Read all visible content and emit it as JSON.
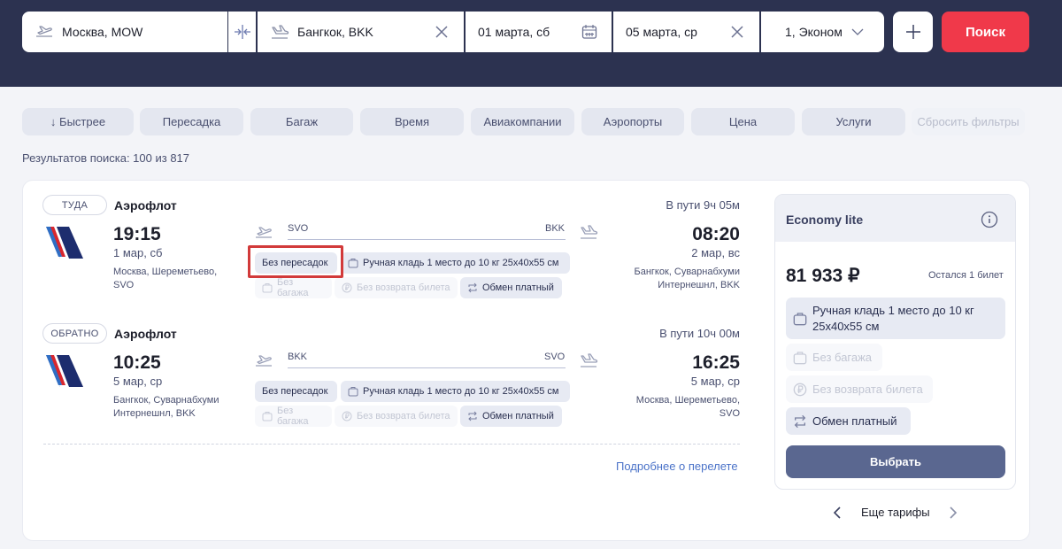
{
  "search": {
    "from": "Москва, MOW",
    "to": "Бангкок, BKK",
    "depart_date": "01 марта, сб",
    "return_date": "05 марта, ср",
    "passengers": "1, Эконом",
    "search_label": "Поиск"
  },
  "filters": [
    "↓ Быстрее",
    "Пересадка",
    "Багаж",
    "Время",
    "Авиакомпании",
    "Аэропорты",
    "Цена",
    "Услуги",
    "Сбросить фильтры"
  ],
  "results_count": "Результатов поиска: 100 из 817",
  "outbound": {
    "badge": "ТУДА",
    "airline": "Аэрофлот",
    "duration": "В пути 9ч 05м",
    "dep_time": "19:15",
    "dep_date": "1 мар, сб",
    "dep_place_1": "Москва, Шереметьево,",
    "dep_place_2": "SVO",
    "dep_iata": "SVO",
    "arr_iata": "BKK",
    "arr_time": "08:20",
    "arr_date": "2 мар, вс",
    "arr_place_1": "Бангкок, Суварнабхуми",
    "arr_place_2": "Интернешнл, BKK",
    "tags": {
      "direct": "Без пересадок",
      "carry_on": "Ручная кладь 1 место до 10 кг 25x40x55 см",
      "no_baggage": "Без багажа",
      "no_refund": "Без возврата билета",
      "exchange": "Обмен платный"
    }
  },
  "inbound": {
    "badge": "ОБРАТНО",
    "airline": "Аэрофлот",
    "duration": "В пути 10ч 00м",
    "dep_time": "10:25",
    "dep_date": "5 мар, ср",
    "dep_place_1": "Бангкок, Суварнабхуми",
    "dep_place_2": "Интернешнл, BKK",
    "dep_iata": "BKK",
    "arr_iata": "SVO",
    "arr_time": "16:25",
    "arr_date": "5 мар, ср",
    "arr_place_1": "Москва, Шереметьево,",
    "arr_place_2": "SVO",
    "tags": {
      "direct": "Без пересадок",
      "carry_on": "Ручная кладь 1 место до 10 кг 25x40x55 см",
      "no_baggage": "Без багажа",
      "no_refund": "Без возврата билета",
      "exchange": "Обмен платный"
    }
  },
  "more_details": "Подробнее о перелете",
  "fare": {
    "title": "Economy lite",
    "price": "81 933 ₽",
    "tickets_left": "Остался 1 билет",
    "carry_on_1": "Ручная кладь 1 место до 10 кг",
    "carry_on_2": "25x40x55 см",
    "no_baggage": "Без багажа",
    "no_refund": "Без возврата билета",
    "exchange": "Обмен платный",
    "select_label": "Выбрать"
  },
  "more_fares": "Еще тарифы",
  "colors": {
    "header_bg": "#2c3250",
    "search_button": "#f0394a",
    "select_button": "#5a6790",
    "link": "#4a72c8",
    "highlight": "#d23a3a"
  }
}
